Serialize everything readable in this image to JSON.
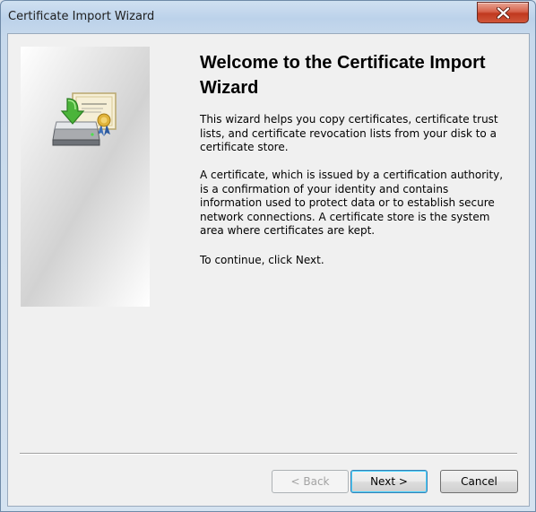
{
  "window": {
    "title": "Certificate Import Wizard"
  },
  "wizard": {
    "heading": "Welcome to the Certificate Import Wizard",
    "paragraph_1": "This wizard helps you copy certificates, certificate trust lists, and certificate revocation lists from your disk to a certificate store.",
    "paragraph_2": "A certificate, which is issued by a certification authority, is a confirmation of your identity and contains information used to protect data or to establish secure network connections. A certificate store is the system area where certificates are kept.",
    "paragraph_3": "To continue, click Next.",
    "icon": "certificate-import-icon"
  },
  "buttons": {
    "back_label": "< Back",
    "back_enabled": false,
    "next_label": "Next >",
    "cancel_label": "Cancel"
  },
  "icons": {
    "close": "close-icon"
  },
  "colors": {
    "close_button": "#c7432a",
    "default_button_border": "#3c7fb1",
    "client_background": "#f0f0f0"
  }
}
